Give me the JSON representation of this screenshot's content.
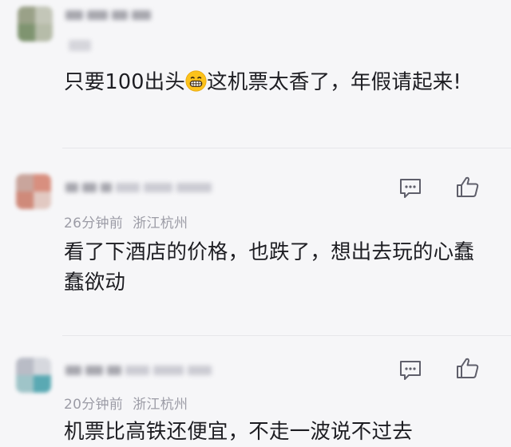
{
  "comments": [
    {
      "time": "",
      "location": "",
      "text_before_emoji": "只要100出头",
      "emoji": "grinning-face-emoji",
      "text_after_emoji": "这机票太香了，年假请起来!"
    },
    {
      "time": "26分钟前",
      "location": "浙江杭州",
      "text": "看了下酒店的价格，也跌了，想出去玩的心蠢蠢欲动"
    },
    {
      "time": "20分钟前",
      "location": "浙江杭州",
      "text": "机票比高铁还便宜，不走一波说不过去"
    }
  ],
  "icons": {
    "reply": "comment-icon",
    "like": "thumbs-up-icon"
  },
  "colors": {
    "background": "#f6f6f8",
    "text": "#1d1d22",
    "meta": "#9c9ca6",
    "icon": "#5f5f6b",
    "divider": "#e6e6ea"
  }
}
